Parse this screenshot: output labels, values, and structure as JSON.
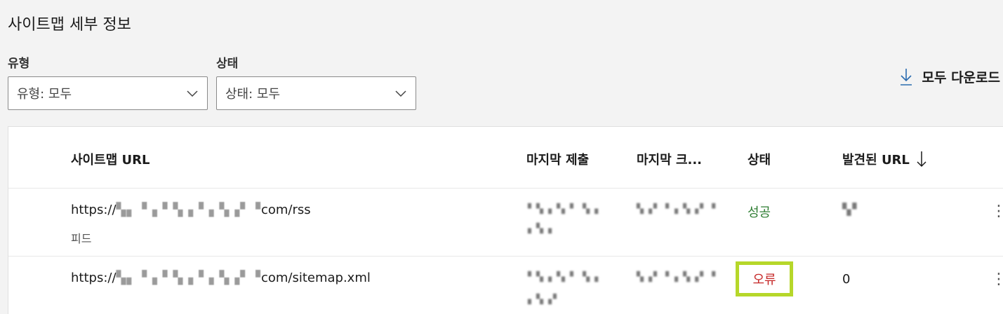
{
  "page": {
    "title": "사이트맵 세부 정보"
  },
  "filters": {
    "type": {
      "label": "유형",
      "value": "유형: 모두"
    },
    "status": {
      "label": "상태",
      "value": "상태: 모두"
    }
  },
  "toolbar": {
    "download_label": "모두 다운로드"
  },
  "table": {
    "headers": {
      "url": "사이트맵 URL",
      "last_submitted": "마지막 제출",
      "last_crawled": "마지막 크...",
      "status": "상태",
      "discovered": "발견된 URL"
    },
    "rows": [
      {
        "url_prefix": "https://",
        "url_mask": "▚▖▝▗ ▘▚▗▝ ▖▚▗▘▝",
        "url_suffix": "com/rss",
        "subtype": "피드",
        "submitted": "▘▚▗▝▖▘ ▚▗",
        "submitted2": "▖▚▗",
        "crawled": "▚▗▘▝ ▖▚▗▘▝",
        "status": "성공",
        "count": "▚▘"
      },
      {
        "url_prefix": "https://",
        "url_mask": "▚▖▝▗ ▘▚▗▝ ▖▚▗▘▝",
        "url_suffix": "com/sitemap.xml",
        "submitted": "▘▚▗▝▖▘ ▚▗",
        "submitted2": "▖▚▗▘",
        "crawled": "▚▗▘▝ ▖▚▗▘▝",
        "status": "오류",
        "count": "0"
      }
    ]
  }
}
